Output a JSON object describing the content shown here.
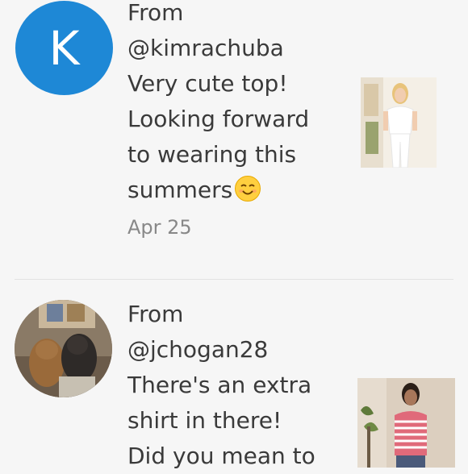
{
  "comments": [
    {
      "avatar_letter": "K",
      "from_label": "From",
      "handle": "@kimrachuba",
      "message_lines": [
        "Very cute top!",
        "Looking forward",
        "to wearing this",
        "summers"
      ],
      "date": "Apr 25",
      "emoji": "smiling-face-emoji"
    },
    {
      "from_label": "From",
      "handle": "@jchogan28",
      "message_lines": [
        "There's an extra",
        "shirt in there!",
        "Did you mean to"
      ]
    }
  ],
  "colors": {
    "avatar_blue": "#1e88d6",
    "background": "#f6f6f6",
    "text": "#3a3a3a",
    "muted": "#888888"
  }
}
